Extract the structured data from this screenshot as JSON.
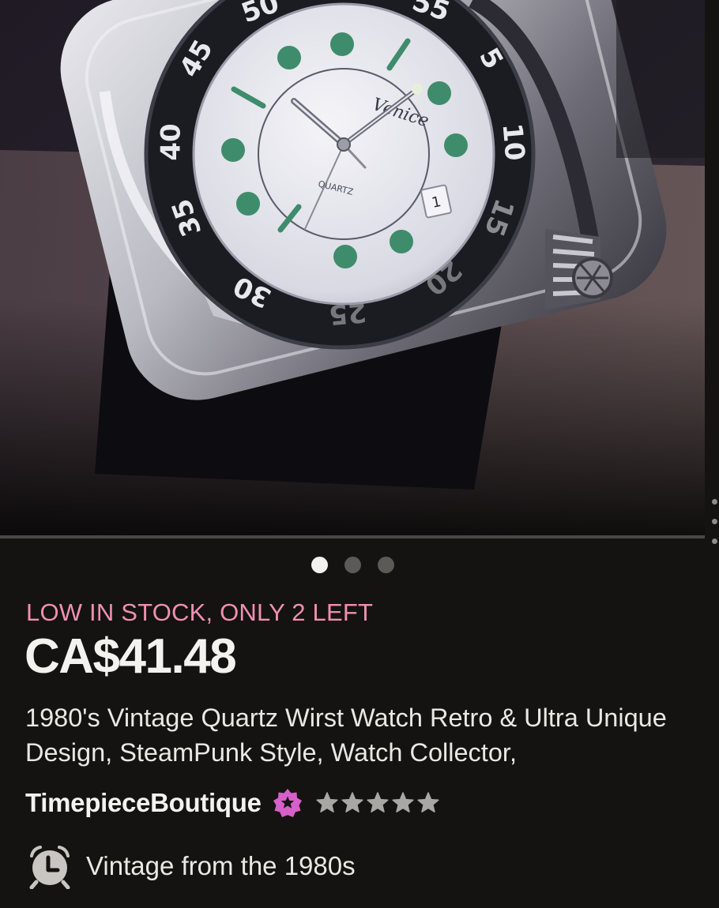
{
  "product": {
    "image_alt": "",
    "dial_brand_text": "Venice",
    "dial_quartz_text": "QUARTZ",
    "date_window": "1",
    "bezel_numbers": [
      "50",
      "55",
      "5",
      "10",
      "15",
      "20",
      "25",
      "30",
      "35",
      "40",
      "45"
    ],
    "carousel": {
      "count": 3,
      "active_index": 0
    },
    "stock_note": "LOW IN STOCK, ONLY 2 LEFT",
    "price": "CA$41.48",
    "title": "1980's Vintage Quartz Wirst Watch Retro & Ultra Unique Design, SteamPunk Style, Watch Collector,",
    "seller": {
      "name": "TimepieceBoutique",
      "badge_icon": "star-seller-badge-icon",
      "rating": 5,
      "rating_max": 5
    },
    "era": {
      "icon": "alarm-clock-icon",
      "text": "Vintage from the 1980s"
    }
  },
  "colors": {
    "background": "#141311",
    "stock_note": "#f08fb3",
    "badge": "#d75fc9",
    "stars": "#a9a7a3",
    "dot_active": "#f2f1ef",
    "dot_inactive": "#5c5a57"
  }
}
